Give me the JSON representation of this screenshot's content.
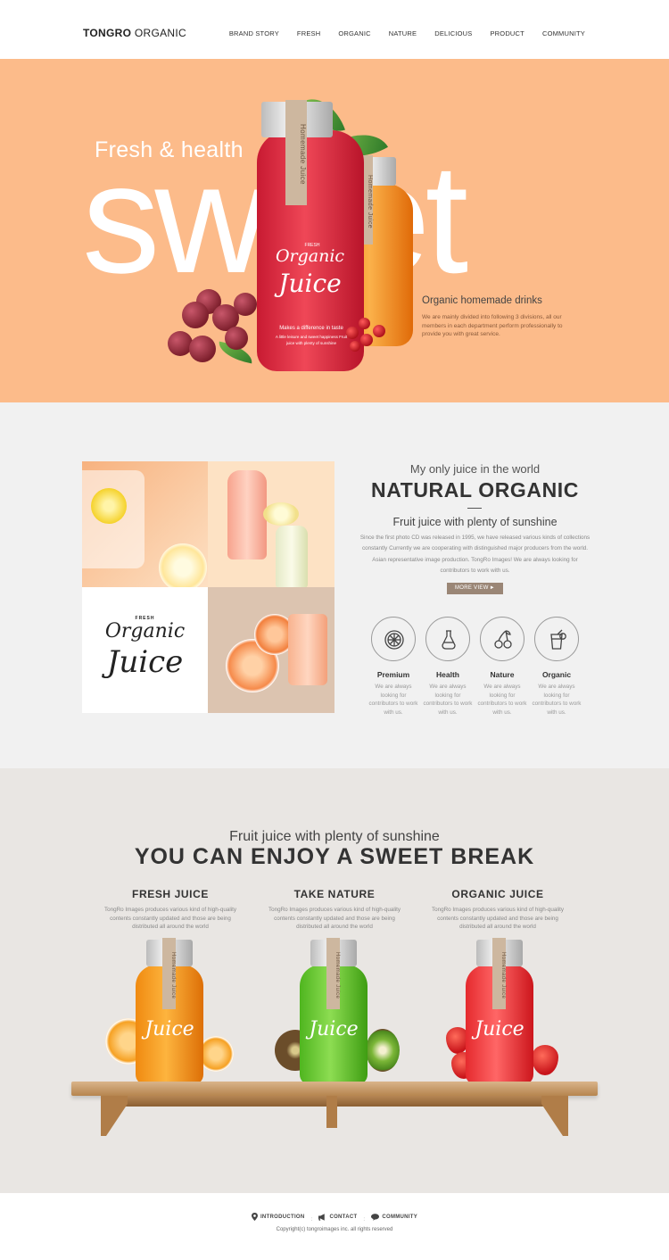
{
  "header": {
    "logo_bold": "TONGRO",
    "logo_light": "ORGANIC",
    "nav": [
      "BRAND STORY",
      "FRESH",
      "ORGANIC",
      "NATURE",
      "DELICIOUS",
      "PRODUCT",
      "COMMUNITY"
    ]
  },
  "hero": {
    "small": "Fresh & health",
    "big": "sweet",
    "subtitle": "Organic homemade drinks",
    "desc": "We are mainly divided into following 3 divisions, all our members in each department perform professionally to provide you with great service.",
    "bottle_strip": "Homemade Juice",
    "bottle_fresh": "FRESH",
    "bottle_mark1": "Organic",
    "bottle_mark2": "Juice",
    "bottle_tagline": "Makes a difference in taste",
    "bottle_small": "A little leisure and sweet happiness Fruit juice with plenty of sunshine",
    "accent_color": "#fcbb8a"
  },
  "about": {
    "eyebrow": "My only juice in the world",
    "title": "NATURAL ORGANIC",
    "subtitle": "Fruit juice with plenty of sunshine",
    "desc": "Since the first photo CD was released in 1995, we have released various kinds of collections constantly Currently we are cooperating with distinguished major producers from the world. Asian representative image production. TongRo Images! We are always looking for contributors to work with us.",
    "more_button": "MORE VIEW",
    "more_arrow": "►",
    "logo_fresh": "FRESH",
    "logo_mark1": "Organic",
    "logo_mark2": "Juice",
    "features": [
      {
        "icon": "citrus-slice-icon",
        "title": "Premium",
        "desc": "We are always looking for contributors to work with us."
      },
      {
        "icon": "carafe-icon",
        "title": "Health",
        "desc": "We are always looking for contributors to work with us."
      },
      {
        "icon": "cherries-icon",
        "title": "Nature",
        "desc": "We are always looking for contributors to work with us."
      },
      {
        "icon": "juice-glass-icon",
        "title": "Organic",
        "desc": "We are always looking for contributors to work with us."
      }
    ]
  },
  "products": {
    "eyebrow": "Fruit juice with plenty of sunshine",
    "title": "YOU CAN ENJOY A SWEET BREAK",
    "columns": [
      {
        "title": "FRESH JUICE",
        "desc": "TongRo Images produces various kind of high-quality contents constantly updated and those are being distributed all around the world",
        "color": "#f7941d"
      },
      {
        "title": "TAKE NATURE",
        "desc": "TongRo Images produces various kind of high-quality contents constantly updated and those are being distributed all around the world",
        "color": "#6ac235"
      },
      {
        "title": "ORGANIC JUICE",
        "desc": "TongRo Images produces various kind of high-quality contents constantly updated and those are being distributed all around the world",
        "color": "#ee3e3e"
      }
    ]
  },
  "footer": {
    "links": [
      {
        "icon": "location-pin-icon",
        "label": "INTRODUCTION"
      },
      {
        "icon": "megaphone-icon",
        "label": "CONTACT"
      },
      {
        "icon": "chat-bubble-icon",
        "label": "COMMUNITY"
      }
    ],
    "separator": ":",
    "copyright": "Copyright(c) tongroimages inc. all rights reserved"
  }
}
